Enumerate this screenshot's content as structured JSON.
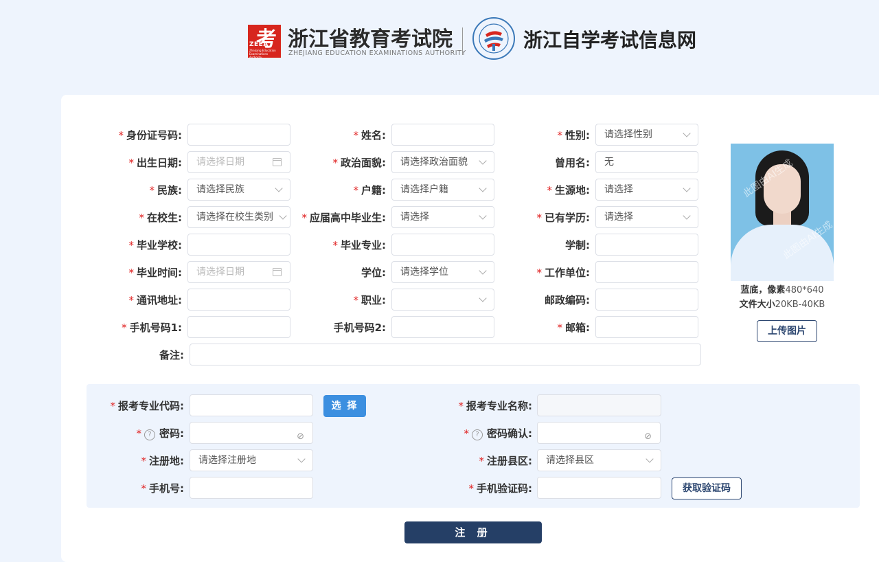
{
  "header": {
    "logo_text": "考",
    "logo_abbr": "ZEEA",
    "logo_small": "Zhejiang Education Examinations Authority",
    "org_name": "浙江省教育考试院",
    "org_name_en": "ZHEJIANG EDUCATION EXAMINATIONS AUTHORITY",
    "site_name": "浙江自学考试信息网"
  },
  "form": {
    "id_card": {
      "label": "身份证号码",
      "value": ""
    },
    "name": {
      "label": "姓名",
      "value": ""
    },
    "gender": {
      "label": "性别",
      "value": "请选择性别"
    },
    "birth_date": {
      "label": "出生日期",
      "placeholder": "请选择日期"
    },
    "political": {
      "label": "政治面貌",
      "value": "请选择政治面貌"
    },
    "former_name": {
      "label": "曾用名",
      "value": "无"
    },
    "ethnicity": {
      "label": "民族",
      "value": "请选择民族"
    },
    "household": {
      "label": "户籍",
      "value": "请选择户籍"
    },
    "origin": {
      "label": "生源地",
      "value": "请选择"
    },
    "in_school": {
      "label": "在校生",
      "value": "请选择在校生类别"
    },
    "hs_graduate": {
      "label": "应届高中毕业生",
      "value": "请选择"
    },
    "education": {
      "label": "已有学历",
      "value": "请选择"
    },
    "school": {
      "label": "毕业学校",
      "value": ""
    },
    "major": {
      "label": "毕业专业",
      "value": ""
    },
    "duration": {
      "label": "学制",
      "value": ""
    },
    "grad_time": {
      "label": "毕业时间",
      "placeholder": "请选择日期"
    },
    "degree": {
      "label": "学位",
      "value": "请选择学位"
    },
    "employer": {
      "label": "工作单位",
      "value": ""
    },
    "address": {
      "label": "通讯地址",
      "value": ""
    },
    "occupation": {
      "label": "职业",
      "value": ""
    },
    "postcode": {
      "label": "邮政编码",
      "value": ""
    },
    "phone1": {
      "label": "手机号码1",
      "value": ""
    },
    "phone2": {
      "label": "手机号码2",
      "value": ""
    },
    "email": {
      "label": "邮箱",
      "value": ""
    },
    "remark": {
      "label": "备注",
      "value": ""
    }
  },
  "photo": {
    "watermark": "此图由AI生成",
    "note1_bold": "蓝底，像素",
    "note1_rest": "480*640",
    "note2_bold": "文件大小",
    "note2_rest": "20KB-40KB",
    "upload_label": "上传图片"
  },
  "apply": {
    "major_code": {
      "label": "报考专业代码",
      "value": ""
    },
    "select_label": "选 择",
    "major_name": {
      "label": "报考专业名称",
      "value": ""
    },
    "password": {
      "label": "密码",
      "value": ""
    },
    "password_confirm": {
      "label": "密码确认",
      "value": ""
    },
    "reg_place": {
      "label": "注册地",
      "value": "请选择注册地"
    },
    "reg_county": {
      "label": "注册县区",
      "value": "请选择县区"
    },
    "mobile": {
      "label": "手机号",
      "value": ""
    },
    "sms_code": {
      "label": "手机验证码",
      "value": ""
    },
    "get_code_label": "获取验证码",
    "submit_label": "注 册"
  }
}
